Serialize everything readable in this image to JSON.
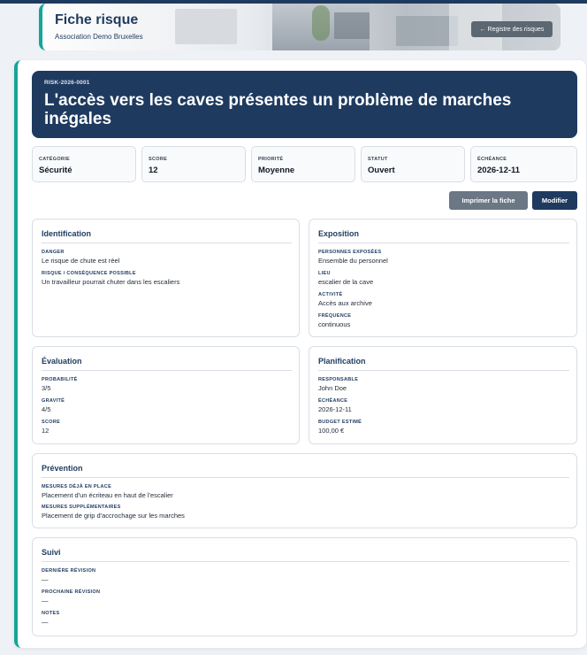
{
  "banner": {
    "title": "Fiche risque",
    "subtitle": "Association Demo Bruxelles",
    "back_label": "← Registre des risques"
  },
  "hero": {
    "code": "RISK-2026-0001",
    "title": "L'accès vers les caves présentes un problème de marches inégales"
  },
  "stats": [
    {
      "label": "CATÉGORIE",
      "value": "Sécurité"
    },
    {
      "label": "SCORE",
      "value": "12"
    },
    {
      "label": "PRIORITÉ",
      "value": "Moyenne"
    },
    {
      "label": "STATUT",
      "value": "Ouvert"
    },
    {
      "label": "ÉCHÉANCE",
      "value": "2026-12-11"
    }
  ],
  "actions": {
    "print_label": "Imprimer la fiche",
    "edit_label": "Modifier"
  },
  "identification": {
    "title": "Identification",
    "fields": [
      {
        "label": "DANGER",
        "value": "Le risque de chute est réel"
      },
      {
        "label": "RISQUE / CONSÉQUENCE POSSIBLE",
        "value": "Un travailleur pourrait chuter dans les escaliers"
      }
    ]
  },
  "exposition": {
    "title": "Exposition",
    "fields": [
      {
        "label": "PERSONNES EXPOSÉES",
        "value": "Ensemble du personnel"
      },
      {
        "label": "LIEU",
        "value": "escalier de la cave"
      },
      {
        "label": "ACTIVITÉ",
        "value": "Accès aux archive"
      },
      {
        "label": "FRÉQUENCE",
        "value": "continuous"
      }
    ]
  },
  "evaluation": {
    "title": "Évaluation",
    "fields": [
      {
        "label": "PROBABILITÉ",
        "value": "3/5"
      },
      {
        "label": "GRAVITÉ",
        "value": "4/5"
      },
      {
        "label": "SCORE",
        "value": "12"
      }
    ]
  },
  "planification": {
    "title": "Planification",
    "fields": [
      {
        "label": "RESPONSABLE",
        "value": "John Doe"
      },
      {
        "label": "ÉCHÉANCE",
        "value": "2026-12-11"
      },
      {
        "label": "BUDGET ESTIMÉ",
        "value": "100,00 €"
      }
    ]
  },
  "prevention": {
    "title": "Prévention",
    "fields": [
      {
        "label": "MESURES DÉJÀ EN PLACE",
        "value": "Placement d'un écriteau en haut de l'escalier"
      },
      {
        "label": "MESURES SUPPLÉMENTAIRES",
        "value": "Placement de grip d'accrochage sur les marches"
      }
    ]
  },
  "suivi": {
    "title": "Suivi",
    "fields": [
      {
        "label": "DERNIÈRE RÉVISION",
        "value": "—"
      },
      {
        "label": "PROCHAINE RÉVISION",
        "value": "—"
      },
      {
        "label": "NOTES",
        "value": "—"
      }
    ]
  }
}
